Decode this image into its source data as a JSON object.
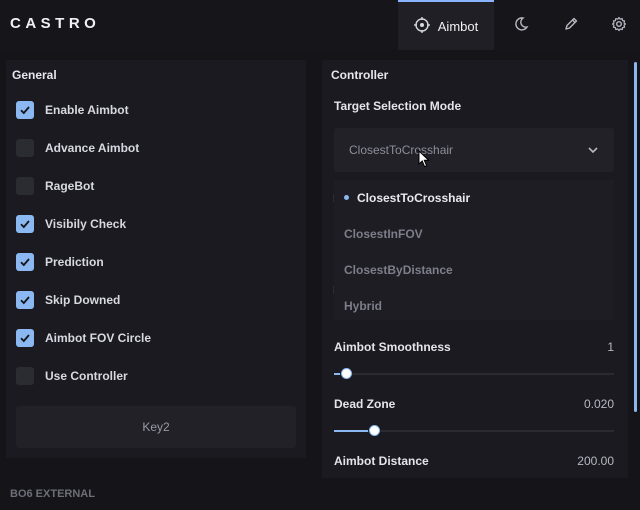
{
  "app": {
    "title": "CASTRO",
    "footer": "BO6 EXTERNAL"
  },
  "tabs": [
    {
      "label": "Aimbot",
      "icon": "crosshair-icon",
      "active": true
    },
    {
      "label": "",
      "icon": "moon-icon",
      "active": false
    },
    {
      "label": "",
      "icon": "pen-icon",
      "active": false
    },
    {
      "label": "",
      "icon": "gear-icon",
      "active": false
    }
  ],
  "general": {
    "title": "General",
    "items": [
      {
        "label": "Enable Aimbot",
        "checked": true
      },
      {
        "label": "Advance Aimbot",
        "checked": false
      },
      {
        "label": "RageBot",
        "checked": false
      },
      {
        "label": "Visibily Check",
        "checked": true
      },
      {
        "label": "Prediction",
        "checked": true
      },
      {
        "label": "Skip Downed",
        "checked": true
      },
      {
        "label": "Aimbot FOV Circle",
        "checked": true
      },
      {
        "label": "Use Controller",
        "checked": false
      }
    ],
    "key_button": "Key2"
  },
  "controller": {
    "title": "Controller",
    "target_mode": {
      "label": "Target Selection Mode",
      "value": "ClosestToCrosshair",
      "options": [
        "ClosestToCrosshair",
        "ClosestInFOV",
        "ClosestByDistance",
        "Hybrid"
      ],
      "selected_index": 0
    },
    "smoothness": {
      "label": "Aimbot Smoothness",
      "value": "1",
      "level": 0.02
    },
    "dead_zone": {
      "label": "Dead Zone",
      "value": "0.020",
      "level": 0.12
    },
    "distance": {
      "label": "Aimbot Distance",
      "value": "200.00"
    }
  },
  "colors": {
    "accent": "#8bb8f0",
    "background": "#141419",
    "panel": "#1a1a20"
  }
}
